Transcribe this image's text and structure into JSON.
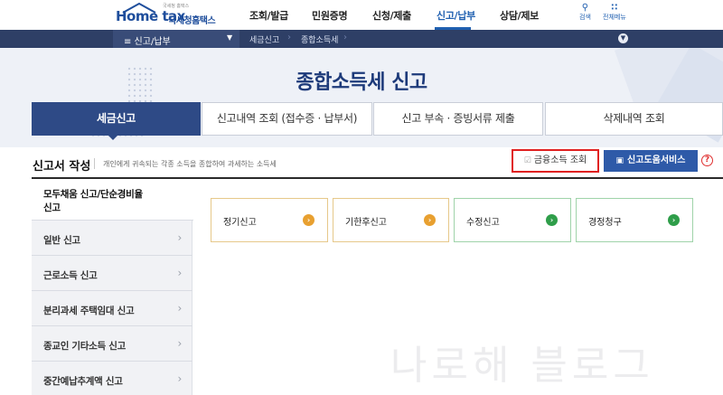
{
  "header": {
    "logo_brand": "Home tax",
    "logo_sub": "국세청홈택스",
    "logo_tiny": "국세청 홈택스",
    "menu": [
      {
        "label": "조회/발급",
        "active": false
      },
      {
        "label": "민원증명",
        "active": false
      },
      {
        "label": "신청/제출",
        "active": false
      },
      {
        "label": "신고/납부",
        "active": true
      },
      {
        "label": "상담/제보",
        "active": false
      }
    ],
    "search_label": "검색",
    "allmenu_label": "전체메뉴"
  },
  "breadcrumb": {
    "menu_label": "≡  신고/납부",
    "items": [
      "세금신고",
      "종합소득세"
    ]
  },
  "hero": {
    "title": "종합소득세 신고"
  },
  "tabs": [
    {
      "label": "세금신고",
      "active": true
    },
    {
      "label": "신고내역 조회 (접수증 · 납부서)",
      "active": false
    },
    {
      "label": "신고 부속 · 증빙서류 제출",
      "active": false
    },
    {
      "label": "삭제내역 조회",
      "active": false
    }
  ],
  "section": {
    "title": "신고서 작성",
    "description": "개인에게 귀속되는 각종 소득을 종합하여 과세하는 소득세",
    "finance_button": "금융소득 조회",
    "help_button": "신고도움서비스",
    "help_q": "?"
  },
  "sidebar": {
    "items": [
      {
        "label_line1": "모두채움 신고/단순경비율",
        "label_line2": "신고",
        "active": true
      },
      {
        "label": "일반 신고",
        "active": false
      },
      {
        "label": "근로소득 신고",
        "active": false
      },
      {
        "label": "분리과세 주택임대 신고",
        "active": false
      },
      {
        "label": "종교인 기타소득 신고",
        "active": false
      },
      {
        "label": "중간예납추계액 신고",
        "active": false
      }
    ]
  },
  "cards": [
    {
      "label": "정기신고",
      "color": "#e8a030"
    },
    {
      "label": "기한후신고",
      "color": "#e8a030"
    },
    {
      "label": "수정신고",
      "color": "#2f9e4a"
    },
    {
      "label": "경정청구",
      "color": "#2f9e4a"
    }
  ],
  "watermark": "나로해 블로그",
  "colors": {
    "navy": "#2e4a86",
    "crumb_bg": "#2e3f66",
    "accent_blue": "#2e5aa8",
    "highlight_red": "#e02020",
    "orange": "#e8a030",
    "green": "#2f9e4a"
  }
}
